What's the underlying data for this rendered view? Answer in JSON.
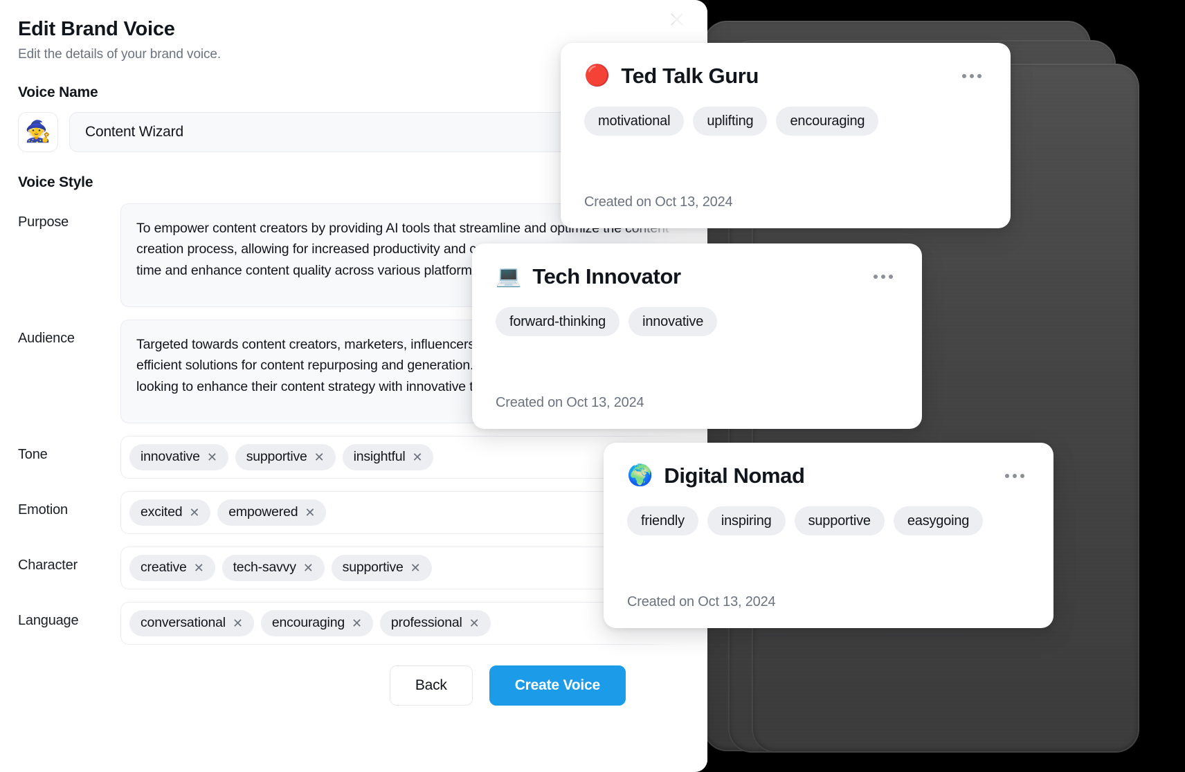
{
  "dialog": {
    "title": "Edit Brand Voice",
    "subtitle": "Edit the details of your brand voice.",
    "close_icon": "close-icon",
    "voice_name_label": "Voice Name",
    "voice_name_emoji": "🧙",
    "voice_name_value": "Content Wizard",
    "voice_name_placeholder": "Voice name",
    "voice_style_label": "Voice Style",
    "fields": [
      {
        "label": "Purpose",
        "type": "textarea",
        "value": "To empower content creators by providing AI tools that streamline and optimize the content creation process, allowing for increased productivity and creativity. The mission is to save time and enhance content quality across various platforms."
      },
      {
        "label": "Audience",
        "type": "textarea",
        "value": "Targeted towards content creators, marketers, influencers, and podcasters who seek efficient solutions for content repurposing and generation. They are tech-savvy individuals looking to enhance their content strategy with innovative tools."
      },
      {
        "label": "Tone",
        "type": "chips",
        "chips": [
          "innovative",
          "supportive",
          "insightful"
        ]
      },
      {
        "label": "Emotion",
        "type": "chips",
        "chips": [
          "excited",
          "empowered"
        ]
      },
      {
        "label": "Character",
        "type": "chips",
        "chips": [
          "creative",
          "tech-savvy",
          "supportive"
        ]
      },
      {
        "label": "Language",
        "type": "chips",
        "chips": [
          "conversational",
          "encouraging",
          "professional"
        ]
      }
    ],
    "chip_remove_glyph": "✕",
    "back_label": "Back",
    "create_label": "Create Voice",
    "primary_color": "#1c9ce8"
  },
  "cards": [
    {
      "id": "ted",
      "emoji": "🔴",
      "name": "Ted Talk Guru",
      "tags": [
        "motivational",
        "uplifting",
        "encouraging"
      ],
      "created": "Created on Oct 13, 2024",
      "menu_icon": "more-options-icon"
    },
    {
      "id": "tech",
      "emoji": "💻",
      "name": "Tech Innovator",
      "tags": [
        "forward-thinking",
        "innovative"
      ],
      "created": "Created on Oct 13, 2024",
      "menu_icon": "more-options-icon"
    },
    {
      "id": "nomad",
      "emoji": "🌍",
      "name": "Digital Nomad",
      "tags": [
        "friendly",
        "inspiring",
        "supportive",
        "easygoing"
      ],
      "created": "Created on Oct 13, 2024",
      "menu_icon": "more-options-icon"
    }
  ]
}
